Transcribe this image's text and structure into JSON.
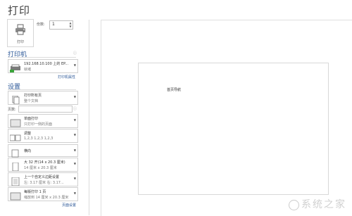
{
  "title": "打印",
  "print_button": {
    "label": "打印"
  },
  "copies": {
    "label": "份数:",
    "value": "1"
  },
  "printer": {
    "section": "打印机",
    "name": "192.168.10.100 上的 EP...",
    "status": "就绪",
    "properties_link": "打印机属性"
  },
  "settings": {
    "section": "设置",
    "pages_label": "页数:",
    "setup_link": "页面设置",
    "items": [
      {
        "line1": "打印所有页",
        "line2": "整个文档"
      },
      {
        "line1": "单面打印",
        "line2": "只打印一侧的页面"
      },
      {
        "line1": "调整",
        "line2": "1,2,3    1,2,3    1,2,3"
      },
      {
        "line1": "横向",
        "line2": ""
      },
      {
        "line1": "大 32 开(14 x 20.3 厘米)",
        "line2": "14 厘米 x 20.3 厘米"
      },
      {
        "line1": "上一个自定义边距设置",
        "line2": "左: 3.17 厘米  右: 3.17..."
      },
      {
        "line1": "每版打印 1 页",
        "line2": "缩放到 14 厘米 x 20.3 厘米"
      }
    ]
  },
  "preview": {
    "doc_text": "首页导航"
  },
  "watermark": "系统之家"
}
